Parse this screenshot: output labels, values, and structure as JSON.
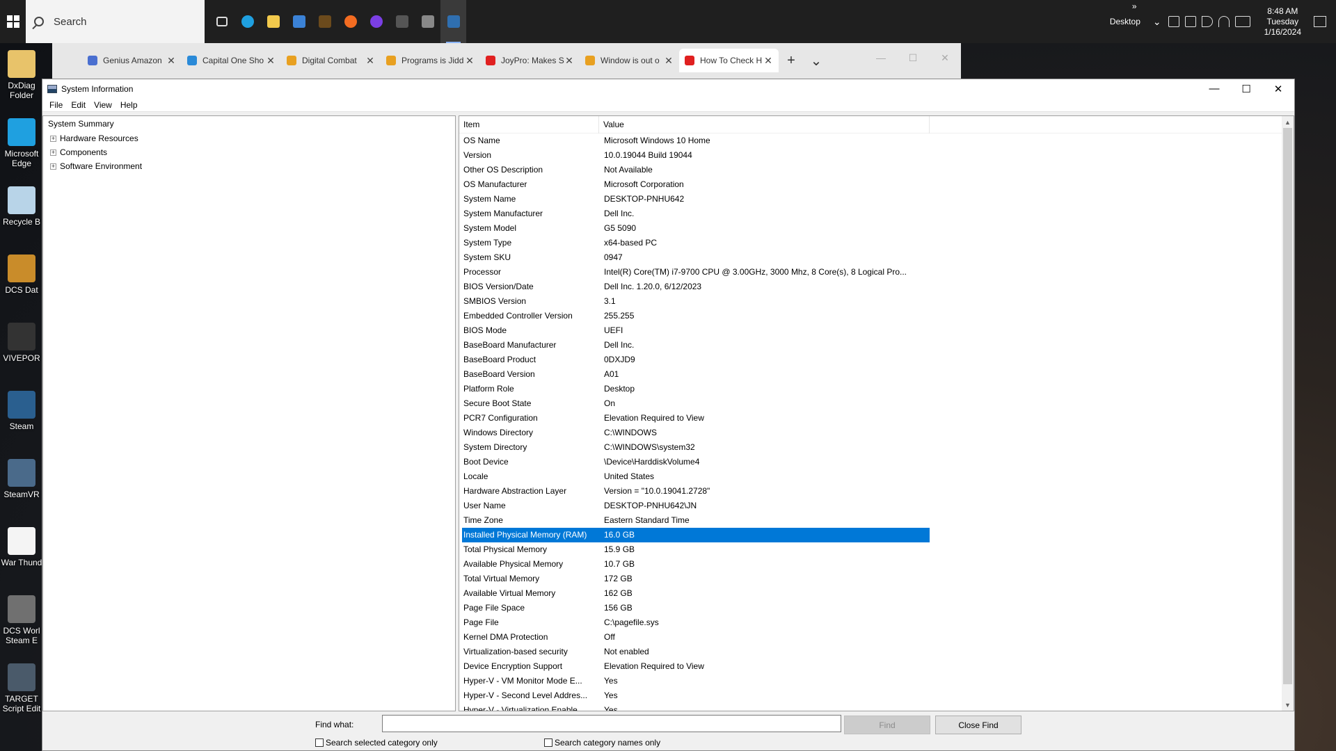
{
  "taskbar": {
    "search_placeholder": "Search",
    "desktop_label": "Desktop",
    "overflow": "»",
    "time": "8:48 AM",
    "day": "Tuesday",
    "date": "1/16/2024",
    "apps": [
      {
        "icon": "task-view-icon",
        "color": "#1f1f1f"
      },
      {
        "icon": "edge-icon",
        "color": "#1fa0e0"
      },
      {
        "icon": "file-explorer-icon",
        "color": "#f2c94c"
      },
      {
        "icon": "ms-store-icon",
        "color": "#3b82d6"
      },
      {
        "icon": "dcs-icon",
        "color": "#6b4a1c"
      },
      {
        "icon": "firefox-icon",
        "color": "#f36c21"
      },
      {
        "icon": "app-purple-icon",
        "color": "#7b3fe4"
      },
      {
        "icon": "settings-icon",
        "color": "#555555"
      },
      {
        "icon": "network-app-icon",
        "color": "#888888"
      },
      {
        "icon": "system-information-icon",
        "color": "#2f6fb0"
      }
    ]
  },
  "desktop_icons": [
    {
      "name": "desktop-icon-dxdiag",
      "label": "DxDiag\nFolder",
      "color": "#e8c36a"
    },
    {
      "name": "desktop-icon-edge",
      "label": "Microsoft\nEdge",
      "color": "#1fa0e0"
    },
    {
      "name": "desktop-icon-recycle-bin",
      "label": "Recycle B",
      "color": "#b8d4e8"
    },
    {
      "name": "desktop-icon-dcs-data",
      "label": "DCS Dat",
      "color": "#c98c2a"
    },
    {
      "name": "desktop-icon-viveport",
      "label": "VIVEPOR",
      "color": "#333333"
    },
    {
      "name": "desktop-icon-steam",
      "label": "Steam",
      "color": "#2a5f8f"
    },
    {
      "name": "desktop-icon-steamvr",
      "label": "SteamVR",
      "color": "#4a6a8a"
    },
    {
      "name": "desktop-icon-war-thunder",
      "label": "War Thund",
      "color": "#f4f4f4"
    },
    {
      "name": "desktop-icon-dcs-world",
      "label": "DCS Worl\nSteam E",
      "color": "#707070"
    },
    {
      "name": "desktop-icon-target-script",
      "label": "TARGET\nScript Edit",
      "color": "#4a5a6a"
    }
  ],
  "browser": {
    "tabs": [
      {
        "title": "Genius Amazon",
        "color": "#4a6fd0"
      },
      {
        "title": "Capital One Sho",
        "color": "#2a8ad8"
      },
      {
        "title": "Digital Combat",
        "color": "#e8a020"
      },
      {
        "title": "Programs is Jidd",
        "color": "#e8a020"
      },
      {
        "title": "JoyPro: Makes S",
        "color": "#e02020"
      },
      {
        "title": "Window is out o",
        "color": "#e8a020"
      },
      {
        "title": "How To Check H",
        "color": "#e02020",
        "active": true
      }
    ],
    "new_tab": "+",
    "tab_list": "⌄"
  },
  "window": {
    "title": "System Information",
    "menu": [
      "File",
      "Edit",
      "View",
      "Help"
    ],
    "tree": {
      "root": "System Summary",
      "children": [
        "Hardware Resources",
        "Components",
        "Software Environment"
      ]
    },
    "columns": {
      "item": "Item",
      "value": "Value"
    },
    "rows": [
      {
        "item": "OS Name",
        "value": "Microsoft Windows 10 Home"
      },
      {
        "item": "Version",
        "value": "10.0.19044 Build 19044"
      },
      {
        "item": "Other OS Description",
        "value": "Not Available"
      },
      {
        "item": "OS Manufacturer",
        "value": "Microsoft Corporation"
      },
      {
        "item": "System Name",
        "value": "DESKTOP-PNHU642"
      },
      {
        "item": "System Manufacturer",
        "value": "Dell Inc."
      },
      {
        "item": "System Model",
        "value": "G5 5090"
      },
      {
        "item": "System Type",
        "value": "x64-based PC"
      },
      {
        "item": "System SKU",
        "value": "0947"
      },
      {
        "item": "Processor",
        "value": "Intel(R) Core(TM) i7-9700 CPU @ 3.00GHz, 3000 Mhz, 8 Core(s), 8 Logical Pro..."
      },
      {
        "item": "BIOS Version/Date",
        "value": "Dell Inc. 1.20.0, 6/12/2023"
      },
      {
        "item": "SMBIOS Version",
        "value": "3.1"
      },
      {
        "item": "Embedded Controller Version",
        "value": "255.255"
      },
      {
        "item": "BIOS Mode",
        "value": "UEFI"
      },
      {
        "item": "BaseBoard Manufacturer",
        "value": "Dell Inc."
      },
      {
        "item": "BaseBoard Product",
        "value": "0DXJD9"
      },
      {
        "item": "BaseBoard Version",
        "value": "A01"
      },
      {
        "item": "Platform Role",
        "value": "Desktop"
      },
      {
        "item": "Secure Boot State",
        "value": "On"
      },
      {
        "item": "PCR7 Configuration",
        "value": "Elevation Required to View"
      },
      {
        "item": "Windows Directory",
        "value": "C:\\WINDOWS"
      },
      {
        "item": "System Directory",
        "value": "C:\\WINDOWS\\system32"
      },
      {
        "item": "Boot Device",
        "value": "\\Device\\HarddiskVolume4"
      },
      {
        "item": "Locale",
        "value": "United States"
      },
      {
        "item": "Hardware Abstraction Layer",
        "value": "Version = \"10.0.19041.2728\""
      },
      {
        "item": "User Name",
        "value": "DESKTOP-PNHU642\\JN"
      },
      {
        "item": "Time Zone",
        "value": "Eastern Standard Time"
      },
      {
        "item": "Installed Physical Memory (RAM)",
        "value": "16.0 GB",
        "selected": true
      },
      {
        "item": "Total Physical Memory",
        "value": "15.9 GB"
      },
      {
        "item": "Available Physical Memory",
        "value": "10.7 GB"
      },
      {
        "item": "Total Virtual Memory",
        "value": "172 GB"
      },
      {
        "item": "Available Virtual Memory",
        "value": "162 GB"
      },
      {
        "item": "Page File Space",
        "value": "156 GB"
      },
      {
        "item": "Page File",
        "value": "C:\\pagefile.sys"
      },
      {
        "item": "Kernel DMA Protection",
        "value": "Off"
      },
      {
        "item": "Virtualization-based security",
        "value": "Not enabled"
      },
      {
        "item": "Device Encryption Support",
        "value": "Elevation Required to View"
      },
      {
        "item": "Hyper-V - VM Monitor Mode E...",
        "value": "Yes"
      },
      {
        "item": "Hyper-V - Second Level Addres...",
        "value": "Yes"
      },
      {
        "item": "Hyper-V - Virtualization Enable...",
        "value": "Yes"
      }
    ],
    "find": {
      "label": "Find what:",
      "value": "",
      "find_button": "Find",
      "close_button": "Close Find",
      "search_selected_only": "Search selected category only",
      "search_names_only": "Search category names only"
    }
  },
  "colors": {
    "selection": "#0078d7",
    "taskbar": "#1f1f1f"
  }
}
